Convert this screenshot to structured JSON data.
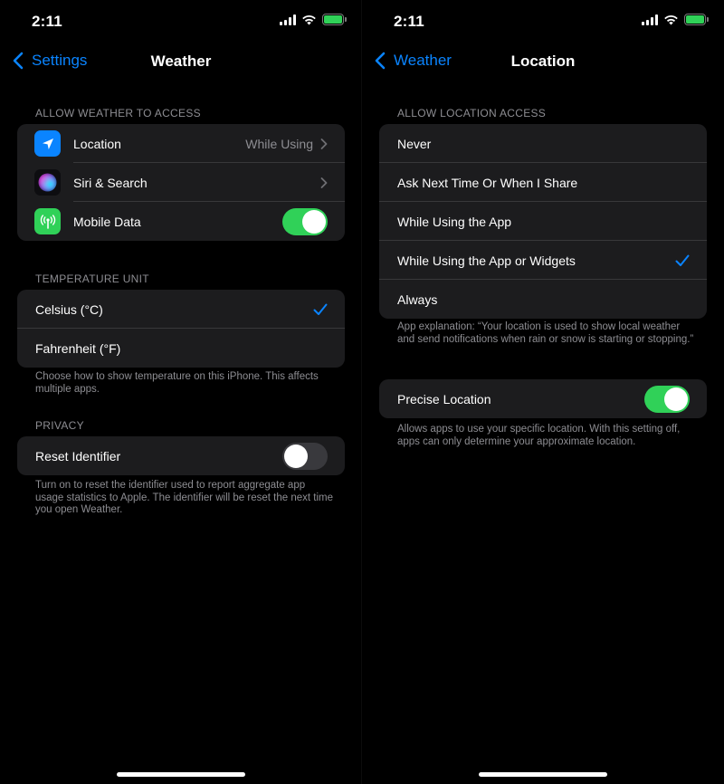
{
  "status": {
    "time": "2:11"
  },
  "left": {
    "back_label": "Settings",
    "title": "Weather",
    "access_header": "ALLOW WEATHER TO ACCESS",
    "access_rows": {
      "location": {
        "label": "Location",
        "value": "While Using"
      },
      "siri": {
        "label": "Siri & Search"
      },
      "mobile_data": {
        "label": "Mobile Data",
        "toggle_on": true
      }
    },
    "temp_header": "TEMPERATURE UNIT",
    "temp_rows": {
      "celsius": {
        "label": "Celsius (°C)",
        "selected": true
      },
      "fahrenheit": {
        "label": "Fahrenheit (°F)",
        "selected": false
      }
    },
    "temp_footer": "Choose how to show temperature on this iPhone. This affects multiple apps.",
    "privacy_header": "PRIVACY",
    "reset_row": {
      "label": "Reset Identifier",
      "toggle_on": false
    },
    "privacy_footer": "Turn on to reset the identifier used to report aggregate app usage statistics to Apple. The identifier will be reset the next time you open Weather."
  },
  "right": {
    "back_label": "Weather",
    "title": "Location",
    "access_header": "ALLOW LOCATION ACCESS",
    "options": {
      "never": "Never",
      "ask": "Ask Next Time Or When I Share",
      "while_using": "While Using the App",
      "while_using_widgets": "While Using the App or Widgets",
      "always": "Always"
    },
    "selected_option": "While Using the App or Widgets",
    "explanation": "App explanation: “Your location is used to show local weather and send notifications when rain or snow is starting or stopping.”",
    "precise": {
      "label": "Precise Location",
      "toggle_on": true
    },
    "precise_footer": "Allows apps to use your specific location. With this setting off, apps can only determine your approximate location."
  },
  "colors": {
    "accent": "#0a84ff",
    "toggle_on": "#30d158",
    "group_bg": "#1c1c1e",
    "secondary_text": "#8d8d92"
  },
  "icons": {
    "location_app": "location-arrow-icon",
    "siri_app": "siri-orb-icon",
    "mobile_data_app": "antenna-icon",
    "checkmark": "checkmark-icon",
    "chevron": "chevron-right-icon",
    "back": "chevron-left-icon"
  }
}
